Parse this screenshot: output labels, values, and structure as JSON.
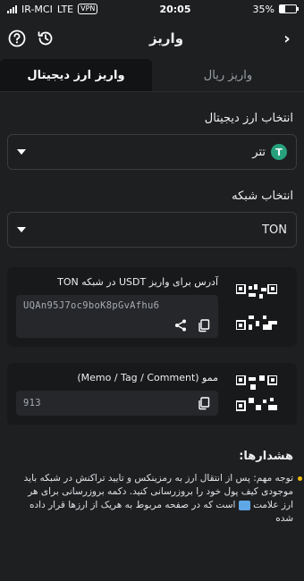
{
  "status_bar": {
    "carrier": "IR-MCI",
    "network": "LTE",
    "vpn": "VPN",
    "time": "20:05",
    "battery": "35%",
    "battery_level": 0.35
  },
  "header": {
    "title": "واریز"
  },
  "tabs": [
    {
      "label": "واریز ارز دیجیتال",
      "active": true
    },
    {
      "label": "واریز ریال",
      "active": false
    }
  ],
  "crypto_select": {
    "label": "انتخاب ارز دیجیتال",
    "value": "تتر",
    "badge": "T"
  },
  "network_select": {
    "label": "انتخاب شبکه",
    "value": "TON"
  },
  "address_card": {
    "title": "آدرس برای واریز USDT در شبکه TON",
    "value": "UQAn95J7oc9boK8pGvAfhu6"
  },
  "memo_card": {
    "title": "ممو (Memo / Tag / Comment)",
    "value": "913"
  },
  "warnings": {
    "title": "هشدارها:",
    "items": [
      "توجه مهم: پس از انتقال ارز به رمزینکس و تایید تراکنش در شبکه باید موجودی کیف پول خود را بروزرسانی کنید. دکمه بروزرسانی برای هر ارز علامت",
      "است که در صفحه مربوط به هریک از ارزها قرار داده شده"
    ]
  },
  "colors": {
    "accent_tether": "#26a17b",
    "bullet": "#f0b90b",
    "background": "#1e1f21"
  }
}
